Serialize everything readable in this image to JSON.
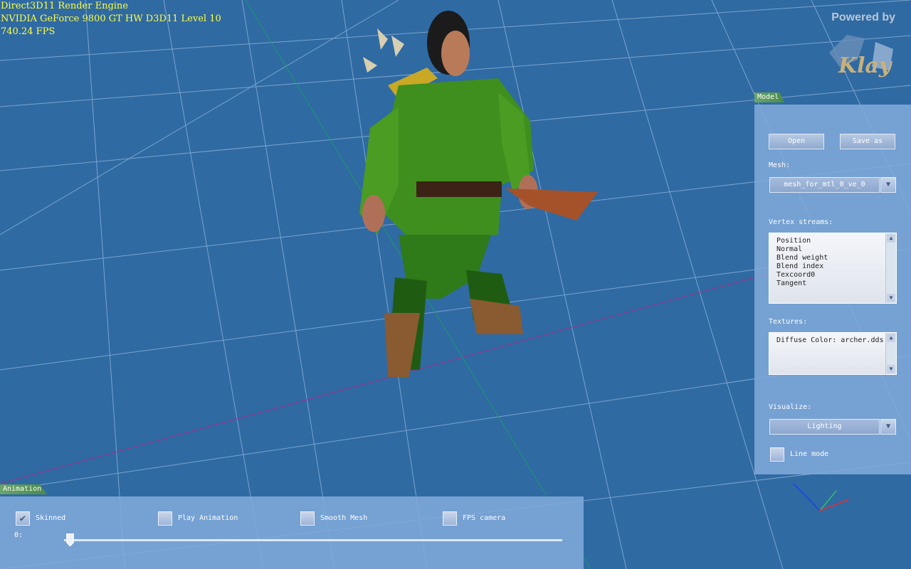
{
  "hud": {
    "line1": "Direct3D11 Render Engine",
    "line2": "NVIDIA GeForce 9800 GT HW D3D11 Level 10",
    "line3": "740.24 FPS"
  },
  "logo": {
    "powered": "Powered by",
    "mark": "Klay"
  },
  "model_panel": {
    "tab": "Model",
    "open": "Open",
    "save_as": "Save as",
    "mesh_label": "Mesh:",
    "mesh_value": "mesh_for_mtl_0_ve_0",
    "streams_label": "Vertex streams:",
    "streams": [
      "Position",
      "Normal",
      "Blend weight",
      "Blend index",
      "Texcoord0",
      "Tangent"
    ],
    "textures_label": "Textures:",
    "textures": [
      "Diffuse Color: archer.dds"
    ],
    "visualize_label": "Visualize:",
    "visualize_value": "Lighting",
    "line_mode": "Line mode",
    "line_mode_checked": false
  },
  "animation_panel": {
    "tab": "Animation",
    "skinned": "Skinned",
    "skinned_checked": true,
    "play_animation": "Play Animation",
    "play_checked": false,
    "smooth_mesh": "Smooth Mesh",
    "smooth_checked": false,
    "fps_camera": "FPS camera",
    "fps_checked": false,
    "frame_label": "0:",
    "frame_value": 0
  },
  "colors": {
    "background": "#2f6aa3",
    "hud_text": "#ffff40",
    "panel": "#82aadc"
  }
}
